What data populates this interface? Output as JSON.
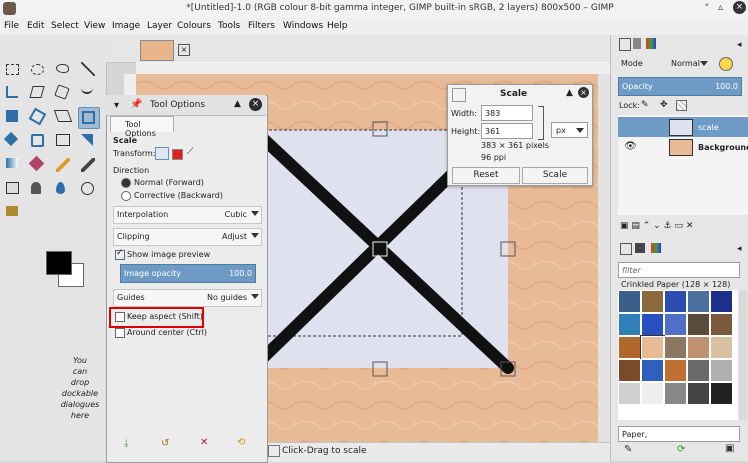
{
  "window": {
    "title": "*[Untitled]-1.0 (RGB colour 8-bit gamma integer, GIMP built-in sRGB, 2 layers) 800x500 – GIMP"
  },
  "menu": [
    "File",
    "Edit",
    "Select",
    "View",
    "Image",
    "Layer",
    "Colours",
    "Tools",
    "Filters",
    "Windows",
    "Help"
  ],
  "toolbox": {
    "dock_hint_lines": [
      "You",
      "can",
      "drop",
      "dockable",
      "dialogues",
      "here"
    ]
  },
  "tool_options": {
    "header_title": "Tool Options",
    "tab_label": "Tool Options",
    "section": "Scale",
    "transform_label": "Transform:",
    "direction_label": "Direction",
    "direction_options": [
      "Normal (Forward)",
      "Corrective (Backward)"
    ],
    "interpolation_label": "Interpolation",
    "interpolation_value": "Cubic",
    "clipping_label": "Clipping",
    "clipping_value": "Adjust",
    "show_preview_label": "Show image preview",
    "image_opacity_label": "Image opacity",
    "image_opacity_value": "100.0",
    "guides_label": "Guides",
    "guides_value": "No guides",
    "keep_aspect_label": "Keep aspect (Shift)",
    "around_center_label": "Around center (Ctrl)"
  },
  "scale_dialog": {
    "title": "Scale",
    "width_label": "Width:",
    "width_value": "383",
    "height_label": "Height:",
    "height_value": "361",
    "unit": "px",
    "size_info": "383 × 361 pixels",
    "ppi_info": "96 ppi",
    "reset_label": "Reset",
    "scale_label": "Scale"
  },
  "status": {
    "text": "Click-Drag to scale"
  },
  "layers": {
    "mode_label": "Mode",
    "mode_value": "Normal",
    "opacity_label": "Opacity",
    "opacity_value": "100.0",
    "lock_label": "Lock:",
    "items": [
      {
        "name": "scale"
      },
      {
        "name": "Background"
      }
    ]
  },
  "patterns": {
    "filter_placeholder": "filter",
    "title": "Crinkled Paper (128 × 128)",
    "name_field": "Paper,"
  },
  "colors": {
    "accent": "#6e9bc5",
    "paper": "#e8bb96",
    "highlight": "#e00000"
  }
}
